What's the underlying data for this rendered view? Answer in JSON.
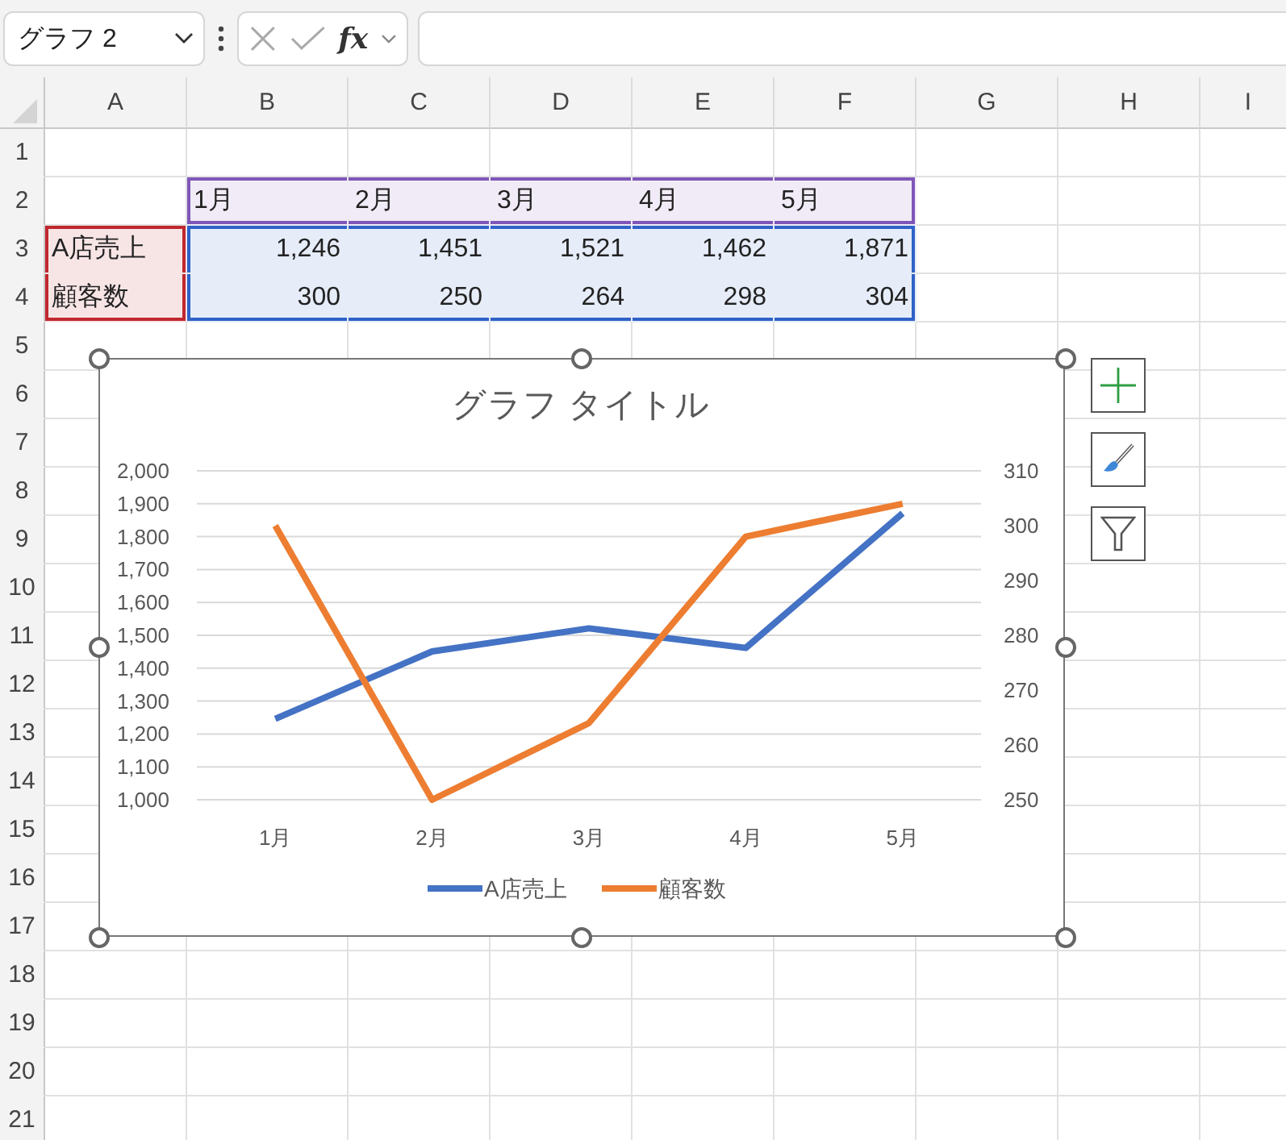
{
  "name_box": {
    "value": "グラフ 2"
  },
  "formula_bar": {
    "fx_label": "fx"
  },
  "columns": [
    "A",
    "B",
    "C",
    "D",
    "E",
    "F",
    "G",
    "H",
    "I"
  ],
  "rows": [
    "1",
    "2",
    "3",
    "4",
    "5",
    "6",
    "7",
    "8",
    "9",
    "10",
    "11",
    "12",
    "13",
    "14",
    "15",
    "16",
    "17",
    "18",
    "19",
    "20",
    "21"
  ],
  "table": {
    "header": [
      "1月",
      "2月",
      "3月",
      "4月",
      "5月"
    ],
    "rows": [
      {
        "label": "A店売上",
        "values": [
          "1,246",
          "1,451",
          "1,521",
          "1,462",
          "1,871"
        ]
      },
      {
        "label": "顧客数",
        "values": [
          "300",
          "250",
          "264",
          "298",
          "304"
        ]
      }
    ],
    "source_ranges": [
      {
        "kind": "categories",
        "color": "#7f56b8"
      },
      {
        "kind": "series_names",
        "color": "#c0282e"
      },
      {
        "kind": "values",
        "color": "#2f62c8"
      }
    ]
  },
  "chart": {
    "selected": true,
    "chart_data": {
      "type": "line",
      "title": "グラフ タイトル",
      "categories": [
        "1月",
        "2月",
        "3月",
        "4月",
        "5月"
      ],
      "series": [
        {
          "name": "A店売上",
          "color": "#4472c4",
          "values": [
            1246,
            1451,
            1521,
            1462,
            1871
          ]
        },
        {
          "name": "顧客数",
          "color": "#ed7d31",
          "axis": "y2",
          "values": [
            300,
            250,
            264,
            298,
            304
          ]
        }
      ],
      "ylim": [
        1000,
        2000
      ],
      "yticks": [
        {
          "value": 1000,
          "label": "1,000"
        },
        {
          "value": 1100,
          "label": "1,100"
        },
        {
          "value": 1200,
          "label": "1,200"
        },
        {
          "value": 1300,
          "label": "1,300"
        },
        {
          "value": 1400,
          "label": "1,400"
        },
        {
          "value": 1500,
          "label": "1,500"
        },
        {
          "value": 1600,
          "label": "1,600"
        },
        {
          "value": 1700,
          "label": "1,700"
        },
        {
          "value": 1800,
          "label": "1,800"
        },
        {
          "value": 1900,
          "label": "1,900"
        },
        {
          "value": 2000,
          "label": "2,000"
        }
      ],
      "y2lim": [
        250,
        310
      ],
      "y2ticks": [
        250,
        260,
        270,
        280,
        290,
        300,
        310
      ],
      "grid": true,
      "legend": "bottom"
    }
  }
}
